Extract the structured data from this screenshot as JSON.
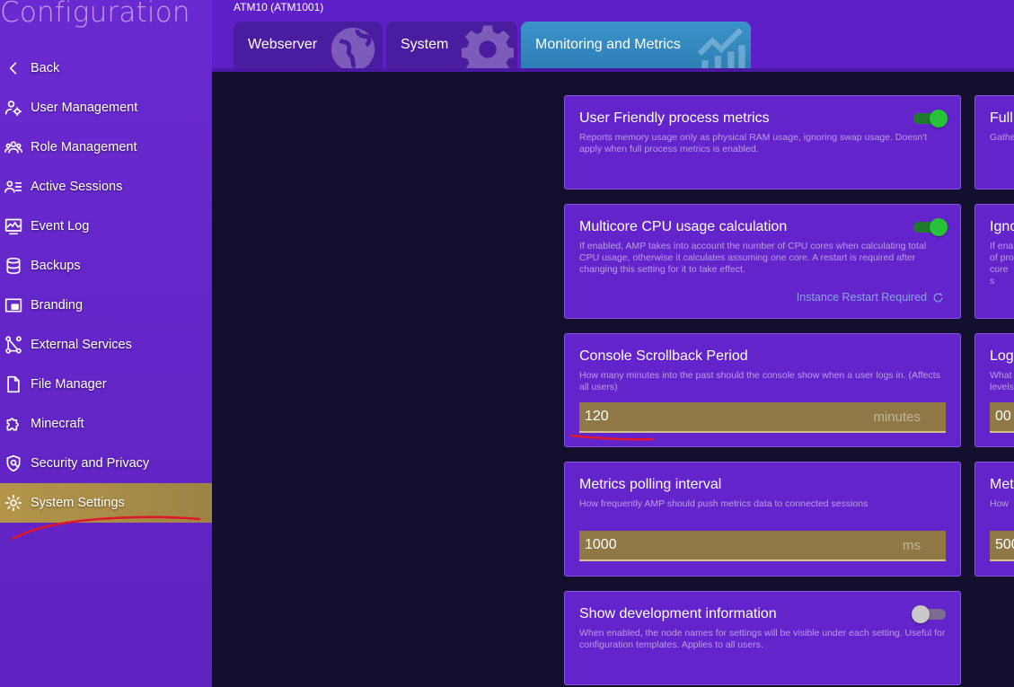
{
  "sidebar": {
    "title": "Configuration",
    "items": [
      {
        "label": "Back",
        "icon": "chevron-left-icon"
      },
      {
        "label": "User Management",
        "icon": "user-gear-icon"
      },
      {
        "label": "Role Management",
        "icon": "group-icon"
      },
      {
        "label": "Active Sessions",
        "icon": "user-list-icon"
      },
      {
        "label": "Event Log",
        "icon": "monitor-chart-icon"
      },
      {
        "label": "Backups",
        "icon": "database-icon"
      },
      {
        "label": "Branding",
        "icon": "picture-in-picture-icon"
      },
      {
        "label": "External Services",
        "icon": "nodes-icon"
      },
      {
        "label": "File Manager",
        "icon": "file-icon"
      },
      {
        "label": "Minecraft",
        "icon": "puzzle-icon"
      },
      {
        "label": "Security and Privacy",
        "icon": "shield-icon"
      },
      {
        "label": "System Settings",
        "icon": "gear-icon",
        "active": true
      }
    ],
    "active_color": "#b4954a"
  },
  "header": {
    "instance": "ATM10 (ATM1001)",
    "tabs": [
      {
        "label": "Webserver",
        "icon": "globe-icon"
      },
      {
        "label": "System",
        "icon": "gear-icon"
      },
      {
        "label": "Monitoring and Metrics",
        "icon": "chart-icon",
        "active": true
      }
    ]
  },
  "settings": {
    "user_friendly": {
      "title": "User Friendly process metrics",
      "desc": "Reports memory usage only as physical RAM usage, ignoring swap usage. Doesn't apply when full process metrics is enabled.",
      "enabled": true
    },
    "multicore": {
      "title": "Multicore CPU usage calculation",
      "desc": "If enabled, AMP takes into account the number of CPU cores when calculating total CPU usage, otherwise it calculates assuming one core. A restart is required after changing this setting for it to take effect.",
      "enabled": true,
      "restart_note": "Instance Restart Required"
    },
    "scrollback": {
      "title": "Console Scrollback Period",
      "desc": "How many minutes into the past should the console show when a user logs in. (Affects all users)",
      "value": "120",
      "unit": "minutes"
    },
    "polling": {
      "title": "Metrics polling interval",
      "desc": "How frequently AMP should push metrics data to connected sessions",
      "value": "1000",
      "unit": "ms"
    },
    "devinfo": {
      "title": "Show development information",
      "desc": "When enabled, the node names for settings will be visible under each setting. Useful for configuration templates. Applies to all users.",
      "enabled": false
    }
  },
  "right_column": {
    "card1_title": "Full",
    "card1_desc": "Gathe",
    "card2_title": "Igno",
    "card2_desc": "If ena of pro core s",
    "card3_title": "Log",
    "card3_desc": "What levels",
    "card3_value": "00",
    "card4_title": "Met",
    "card4_desc": "How",
    "card4_value": "500"
  },
  "colors": {
    "sidebar": "#6a2ad0",
    "card": "#6424cc",
    "input": "#8f7746",
    "toggle_on": "#28c23a",
    "tab_active": "#3c93c9",
    "annotation": "#e0162b"
  }
}
